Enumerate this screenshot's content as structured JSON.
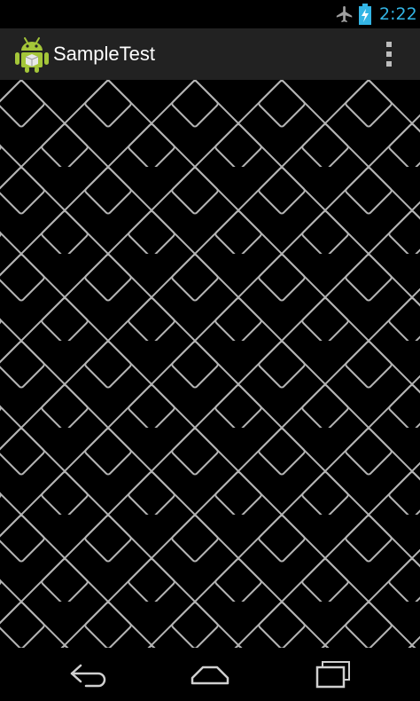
{
  "status_bar": {
    "time": "2:22",
    "time_color": "#33b5e5",
    "icons": [
      "airplane-icon",
      "battery-charging-icon"
    ]
  },
  "action_bar": {
    "title": "SampleTest",
    "background": "#222222",
    "app_icon": "android-robot-icon",
    "overflow_icon": "overflow-menu-icon"
  },
  "content": {
    "pattern": "diamond-lattice",
    "background": "#000000",
    "line_color": "#b4b4b4"
  },
  "nav_bar": {
    "buttons": [
      "back-icon",
      "home-icon",
      "recents-icon"
    ]
  }
}
